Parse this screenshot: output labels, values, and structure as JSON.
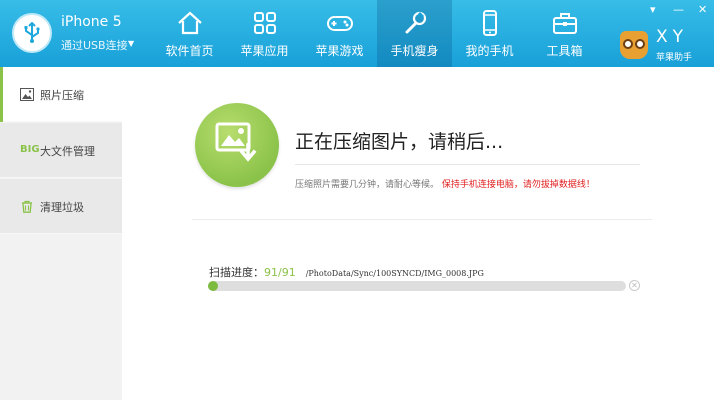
{
  "device": {
    "name": "iPhone 5",
    "connection": "通过USB连接",
    "dropdown_icon": "chevron-down-icon"
  },
  "nav": [
    {
      "label": "软件首页",
      "icon": "home-icon",
      "active": false
    },
    {
      "label": "苹果应用",
      "icon": "apps-grid-icon",
      "active": false
    },
    {
      "label": "苹果游戏",
      "icon": "gamepad-icon",
      "active": false
    },
    {
      "label": "手机瘦身",
      "icon": "wrench-icon",
      "active": true
    },
    {
      "label": "我的手机",
      "icon": "phone-icon",
      "active": false
    },
    {
      "label": "工具箱",
      "icon": "toolbox-icon",
      "active": false
    }
  ],
  "window": {
    "minimize_glyph": "▾",
    "min_glyph": "—",
    "close_glyph": "✕"
  },
  "logo": {
    "text": "XY",
    "subtitle": "苹果助手"
  },
  "sidebar": {
    "items": [
      {
        "label": "照片压缩",
        "icon": "photo-icon",
        "active": true
      },
      {
        "label": "大文件管理",
        "icon_text": "BIG",
        "active": false
      },
      {
        "label": "清理垃圾",
        "icon": "trash-icon",
        "active": false
      }
    ]
  },
  "main": {
    "title": "正在压缩图片，请稍后...",
    "desc": "压缩照片需要几分钟，请耐心等候。",
    "warning": "保持手机连接电脑，请勿拔掉数据线！",
    "scan_label": "扫描进度：",
    "scan_count": "91/91",
    "scan_path": "/PhotoData/Sync/100SYNCD/IMG_0008.JPG",
    "progress": 0.02
  },
  "colors": {
    "header": "#1ea8dc",
    "accent_green": "#8bc34a",
    "warning_red": "#e02020"
  }
}
